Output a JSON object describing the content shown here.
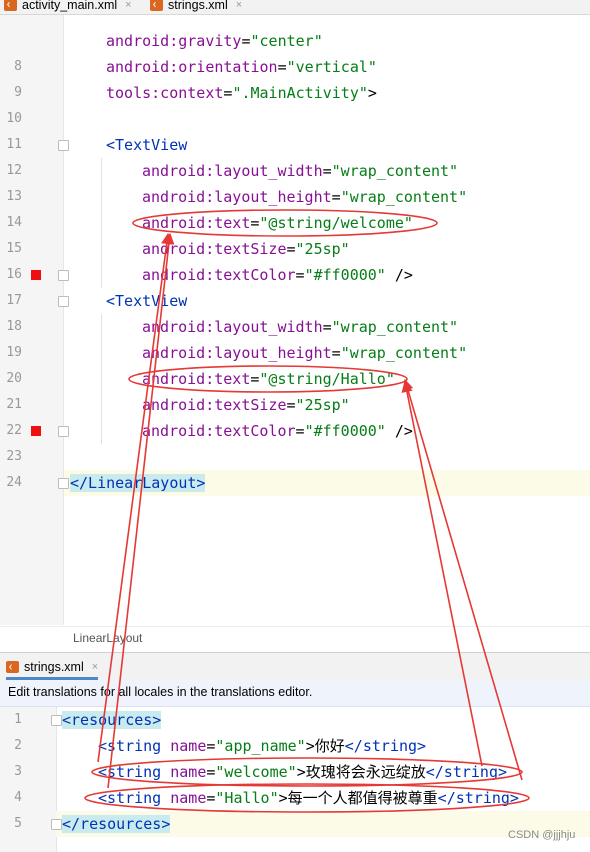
{
  "tabs": {
    "activity": "activity_main.xml",
    "strings": "strings.xml",
    "close_glyph": "×"
  },
  "editor1": {
    "line_numbers": [
      "8",
      "9",
      "10",
      "11",
      "12",
      "13",
      "14",
      "15",
      "16",
      "17",
      "18",
      "19",
      "20",
      "21",
      "22",
      "23",
      "24"
    ],
    "line_7": {
      "attr": "android:gravity",
      "eq": "=",
      "val": "\"center\""
    },
    "line_8": {
      "attr": "android:orientation",
      "eq": "=",
      "val": "\"vertical\""
    },
    "line_9": {
      "attr": "tools:context",
      "eq": "=",
      "val": "\".MainActivity\"",
      "close": ">"
    },
    "tv1": {
      "open": "<TextView",
      "w_attr": "android:layout_width",
      "w_val": "\"wrap_content\"",
      "h_attr": "android:layout_height",
      "h_val": "\"wrap_content\"",
      "t_attr": "android:text",
      "t_val": "\"@string/welcome\"",
      "s_attr": "android:textSize",
      "s_val": "\"25sp\"",
      "c_attr": "android:textColor",
      "c_val": "\"#ff0000\"",
      "close": " />"
    },
    "tv2": {
      "open": "<TextView",
      "w_attr": "android:layout_width",
      "w_val": "\"wrap_content\"",
      "h_attr": "android:layout_height",
      "h_val": "\"wrap_content\"",
      "t_attr": "android:text",
      "t_val": "\"@string/Hallo\"",
      "s_attr": "android:textSize",
      "s_val": "\"25sp\"",
      "c_attr": "android:textColor",
      "c_val": "\"#ff0000\"",
      "close": " />"
    },
    "end_tag": "</LinearLayout>",
    "breadcrumb": "LinearLayout"
  },
  "editor2": {
    "tab": "strings.xml",
    "banner": "Edit translations for all locales in the translations editor.",
    "line_numbers": [
      "1",
      "2",
      "3",
      "4",
      "5"
    ],
    "res_open": "<resources>",
    "res_close": "</resources>",
    "rows": [
      {
        "open": "<string ",
        "attr": "name",
        "val": "\"app_name\"",
        "text": "你好",
        "close": "</string>"
      },
      {
        "open": "<string ",
        "attr": "name",
        "val": "\"welcome\"",
        "text": "玫瑰将会永远绽放",
        "close": "</string>"
      },
      {
        "open": "<string ",
        "attr": "name",
        "val": "\"Hallo\"",
        "text": "每一个人都值得被尊重",
        "close": "</string>"
      }
    ]
  },
  "watermark": "CSDN @jjjhju",
  "colors": {
    "attr": "#871094",
    "value": "#067d17",
    "tag": "#0033b3",
    "annotation": "#e53935",
    "breakpoint": "#ee1010",
    "tab_underline": "#4a88c7"
  },
  "icons": [
    "xml-file-icon",
    "close-icon",
    "breakpoint-icon",
    "fold-marker-icon"
  ]
}
